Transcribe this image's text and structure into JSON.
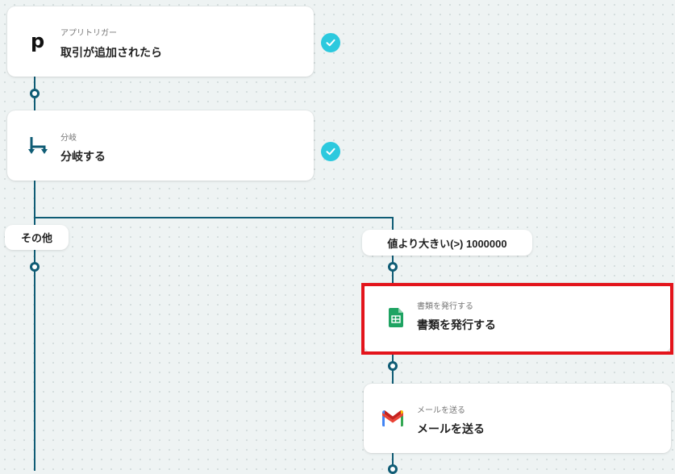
{
  "steps": [
    {
      "sub": "アプリトリガー",
      "main": "取引が追加されたら",
      "icon": "p-logo-icon"
    },
    {
      "sub": "分岐",
      "main": "分岐する",
      "icon": "branch-icon"
    },
    {
      "sub": "書類を発行する",
      "main": "書類を発行する",
      "icon": "google-sheets-icon"
    },
    {
      "sub": "メールを送る",
      "main": "メールを送る",
      "icon": "gmail-icon"
    }
  ],
  "branches": {
    "left_label": "その他",
    "right_label": "値より大きい(>) 1000000"
  },
  "colors": {
    "connector": "#0f5c75",
    "check": "#2cc9de",
    "highlight": "#e3141b"
  }
}
